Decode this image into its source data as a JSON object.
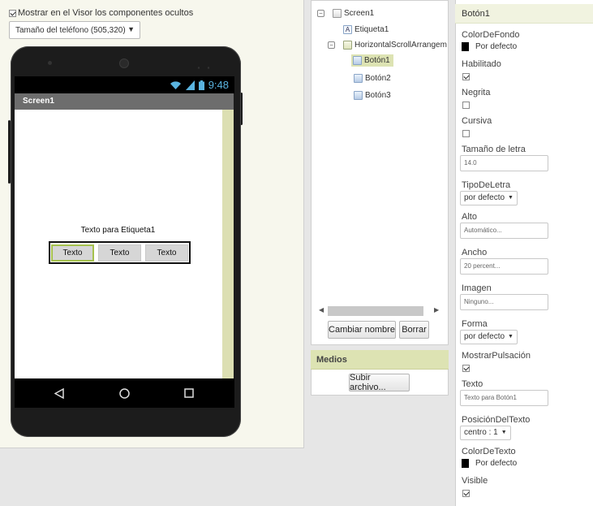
{
  "viewer": {
    "show_hidden_label": "Mostrar en el Visor los componentes ocultos",
    "show_hidden_checked": true,
    "size_select_value": "Tamaño del teléfono (505,320)",
    "phone": {
      "time": "9:48",
      "screen_title": "Screen1",
      "label_text": "Texto para Etiqueta1",
      "buttons": [
        "Texto",
        "Texto",
        "Texto"
      ]
    }
  },
  "tree": {
    "nodes": [
      "Screen1",
      "Etiqueta1",
      "HorizontalScrollArrangem",
      "Botón1",
      "Botón2",
      "Botón3"
    ],
    "rename_button": "Cambiar nombre",
    "delete_button": "Borrar"
  },
  "media": {
    "title": "Medios",
    "upload_button": "Subir archivo..."
  },
  "properties": {
    "component": "Botón1",
    "colordefondo_label": "ColorDeFondo",
    "colordefondo_value": "Por defecto",
    "habilitado_label": "Habilitado",
    "negrita_label": "Negrita",
    "cursiva_label": "Cursiva",
    "tamano_label": "Tamaño de letra",
    "tamano_value": "14.0",
    "tipo_label": "TipoDeLetra",
    "tipo_value": "por defecto",
    "alto_label": "Alto",
    "alto_value": "Automático...",
    "ancho_label": "Ancho",
    "ancho_value": "20 percent...",
    "imagen_label": "Imagen",
    "imagen_value": "Ninguno...",
    "forma_label": "Forma",
    "forma_value": "por defecto",
    "mostrar_label": "MostrarPulsación",
    "texto_label": "Texto",
    "texto_value": "Texto para Botón1",
    "posicion_label": "PosiciónDelTexto",
    "posicion_value": "centro : 1",
    "colortexto_label": "ColorDeTexto",
    "colortexto_value": "Por defecto",
    "visible_label": "Visible"
  }
}
